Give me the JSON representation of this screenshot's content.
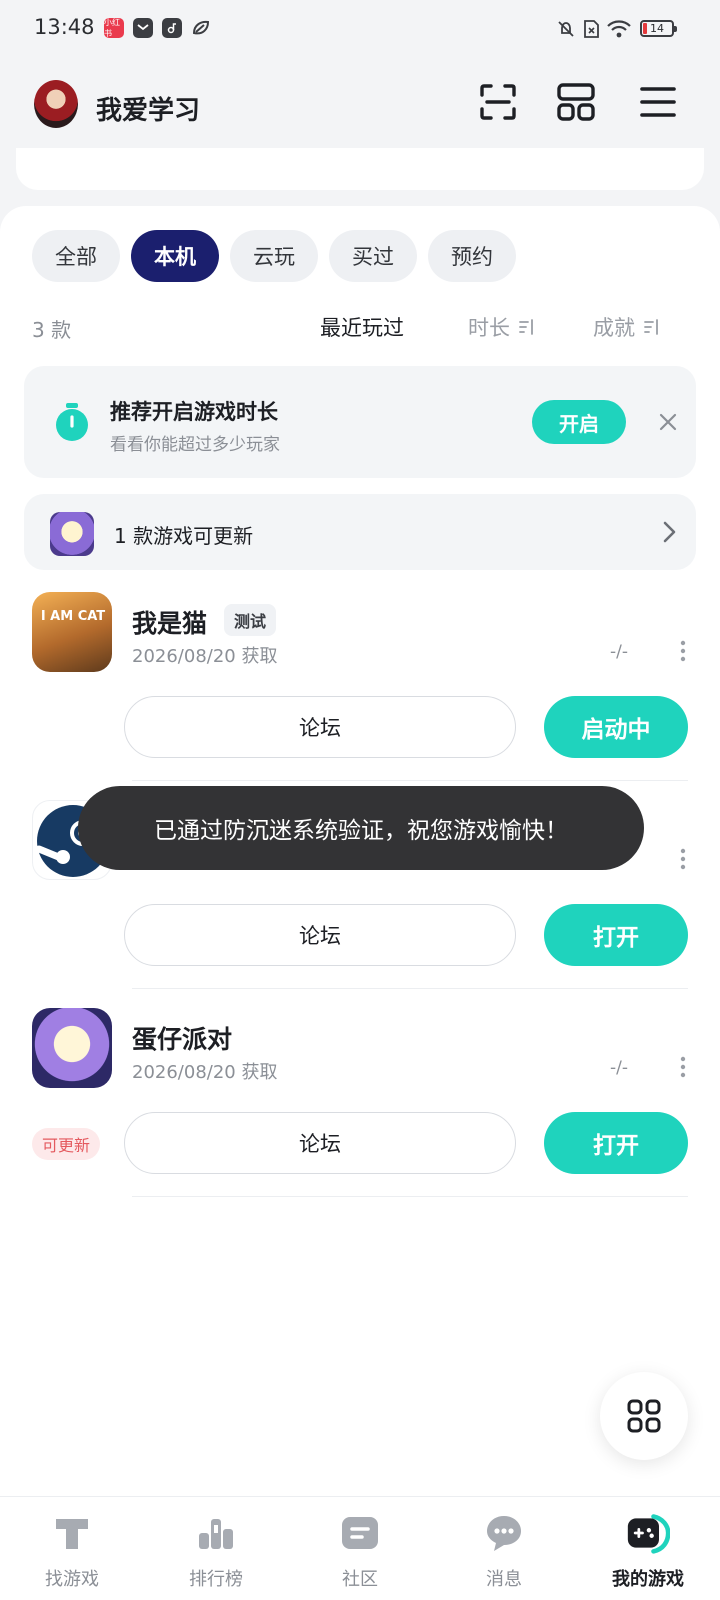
{
  "status_bar": {
    "time": "13:48",
    "notification_badge_text": "小红书",
    "battery": "14"
  },
  "header": {
    "username": "我爱学习"
  },
  "filter_tabs": [
    "全部",
    "本机",
    "云玩",
    "买过",
    "预约"
  ],
  "active_filter": "本机",
  "sort_row": {
    "count": "3 款",
    "options": [
      "最近玩过",
      "时长",
      "成就"
    ],
    "active": "最近玩过"
  },
  "banner": {
    "title": "推荐开启游戏时长",
    "subtitle": "看看你能超过多少玩家",
    "button": "开启"
  },
  "update_notice": "1 款游戏可更新",
  "games": [
    {
      "name": "我是猫",
      "tag": "测试",
      "date": "2026/08/20 获取",
      "stat": "-/-",
      "forum": "论坛",
      "action": "启动中"
    },
    {
      "name": "",
      "date": "",
      "stat": "-/-",
      "forum": "论坛",
      "action": "打开"
    },
    {
      "name": "蛋仔派对",
      "date": "2026/08/20 获取",
      "stat": "-/-",
      "forum": "论坛",
      "action": "打开",
      "badge": "可更新"
    }
  ],
  "toast": "已通过防沉迷系统验证，祝您游戏愉快！",
  "bottom_nav": [
    "找游戏",
    "排行榜",
    "社区",
    "消息",
    "我的游戏"
  ],
  "active_nav": "我的游戏",
  "colors": {
    "accent": "#1fd3bd",
    "active_tab": "#1b1f6e",
    "update_badge": "#e45a5f"
  },
  "icons": {
    "header": [
      "scan-icon",
      "layout-icon",
      "menu-icon"
    ],
    "banner": [
      "stopwatch-icon",
      "close-icon"
    ],
    "fab": "apps-grid-icon"
  }
}
